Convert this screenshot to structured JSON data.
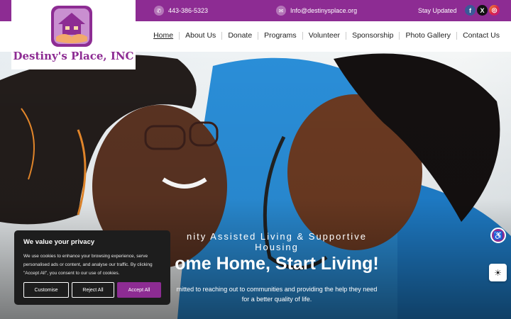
{
  "topbar": {
    "phone": "443-386-5323",
    "email": "Info@destinysplace.org",
    "stay_updated": "Stay Updated",
    "social": [
      {
        "name": "facebook",
        "glyph": "f",
        "color": "#3b5998"
      },
      {
        "name": "x",
        "glyph": "X",
        "color": "#111111"
      },
      {
        "name": "instagram",
        "glyph": "◎",
        "color": "#d6249f"
      }
    ]
  },
  "logo": {
    "name": "Destiny's Place, INC"
  },
  "nav": {
    "items": [
      "Home",
      "About Us",
      "Donate",
      "Programs",
      "Volunteer",
      "Sponsorship",
      "Photo Gallery",
      "Contact Us"
    ],
    "active": "Home"
  },
  "hero": {
    "tagline_line1": "nity Assisted Living & Supportive",
    "tagline_line2": "Housing",
    "headline": "ome Home, Start Living!",
    "desc_line1": "mitted to reaching out to communities and providing the help they need",
    "desc_line2": "for a better quality of life."
  },
  "cookie": {
    "title": "We value your privacy",
    "text": "We use cookies to enhance your browsing experience, serve personalised ads or content, and analyse our traffic. By clicking \"Accept All\", you consent to our use of cookies.",
    "customise": "Customise",
    "reject": "Reject All",
    "accept": "Accept All"
  },
  "colors": {
    "brand": "#8d2c93",
    "cookie_bg": "#1d1d1d"
  }
}
